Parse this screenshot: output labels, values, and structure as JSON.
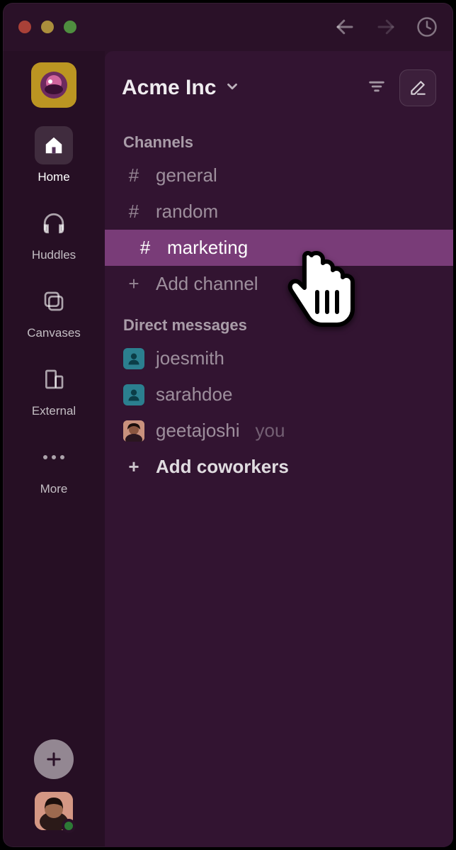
{
  "window": {
    "traffic_lights": [
      "close",
      "minimize",
      "zoom"
    ]
  },
  "rail": {
    "items": [
      {
        "label": "Home",
        "icon": "home-icon",
        "active": true
      },
      {
        "label": "Huddles",
        "icon": "headphones-icon",
        "active": false
      },
      {
        "label": "Canvases",
        "icon": "canvases-icon",
        "active": false
      },
      {
        "label": "External",
        "icon": "building-icon",
        "active": false
      },
      {
        "label": "More",
        "icon": "more-icon",
        "active": false
      }
    ]
  },
  "sidebar": {
    "workspace_name": "Acme Inc",
    "sections": {
      "channels_header": "Channels",
      "channels": [
        {
          "name": "general",
          "selected": false
        },
        {
          "name": "random",
          "selected": false
        },
        {
          "name": "marketing",
          "selected": true
        }
      ],
      "add_channel_label": "Add channel",
      "dms_header": "Direct messages",
      "dms": [
        {
          "name": "joesmith",
          "you": false,
          "avatar": "blue"
        },
        {
          "name": "sarahdoe",
          "you": false,
          "avatar": "blue"
        },
        {
          "name": "geetajoshi",
          "you": true,
          "avatar": "photo"
        }
      ],
      "add_coworkers_label": "Add coworkers",
      "you_suffix": "you"
    }
  },
  "icons": {
    "hash": "#",
    "plus": "+"
  },
  "colors": {
    "bg": "#2a1128",
    "panel": "#321431",
    "selected_band": "#793c78",
    "selected_pill": "#a557a3",
    "workspace_tile": "#bb9522"
  }
}
